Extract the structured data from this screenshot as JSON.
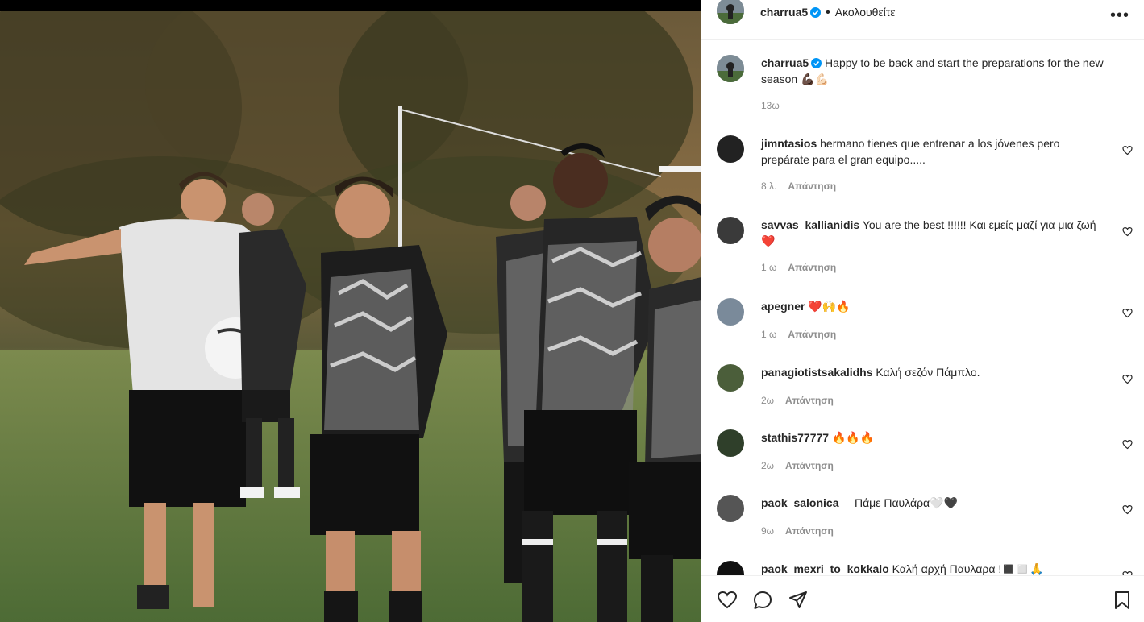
{
  "post": {
    "author": "charrua5",
    "follow_state": "Ακολουθείτε",
    "caption_text": "Happy to be back and start the preparations for the new season 💪🏿💪🏻",
    "caption_time": "13ω"
  },
  "reply_label": "Απάντηση",
  "comments": [
    {
      "user": "jimntasios",
      "text": "hermano tienes que entrenar a los jóvenes pero prepárate para el gran equipo.....",
      "time": "8 λ.",
      "avatar_color": "#222222"
    },
    {
      "user": "savvas_kallianidis",
      "text": "You are the best !!!!!! Και εμείς μαζί για μια ζωή ❤️",
      "time": "1 ω",
      "avatar_color": "#3a3a3a"
    },
    {
      "user": "apegner",
      "text": "❤️🙌🔥",
      "time": "1 ω",
      "avatar_color": "#7a8a9a"
    },
    {
      "user": "panagiotistsakalidhs",
      "text": "Καλή σεζόν Πάμπλο.",
      "time": "2ω",
      "avatar_color": "#4b5e3a"
    },
    {
      "user": "stathis77777",
      "text": "🔥🔥🔥",
      "time": "2ω",
      "avatar_color": "#2f3f2a"
    },
    {
      "user": "paok_salonica__",
      "text": "Πάμε Παυλάρα🤍🖤",
      "time": "9ω",
      "avatar_color": "#555555"
    },
    {
      "user": "paok_mexri_to_kokkalo",
      "text": "Καλή αρχή Παυλαρα !◼️◻️🙏",
      "time": "",
      "avatar_color": "#111111"
    }
  ],
  "icons": {
    "like": "heart-icon",
    "comment": "comment-icon",
    "share": "share-icon",
    "save": "bookmark-icon",
    "more": "more-options-icon",
    "verified": "verified-badge-icon"
  },
  "colors": {
    "verified": "#0095f6",
    "text": "#262626",
    "muted": "#8e8e8e"
  }
}
